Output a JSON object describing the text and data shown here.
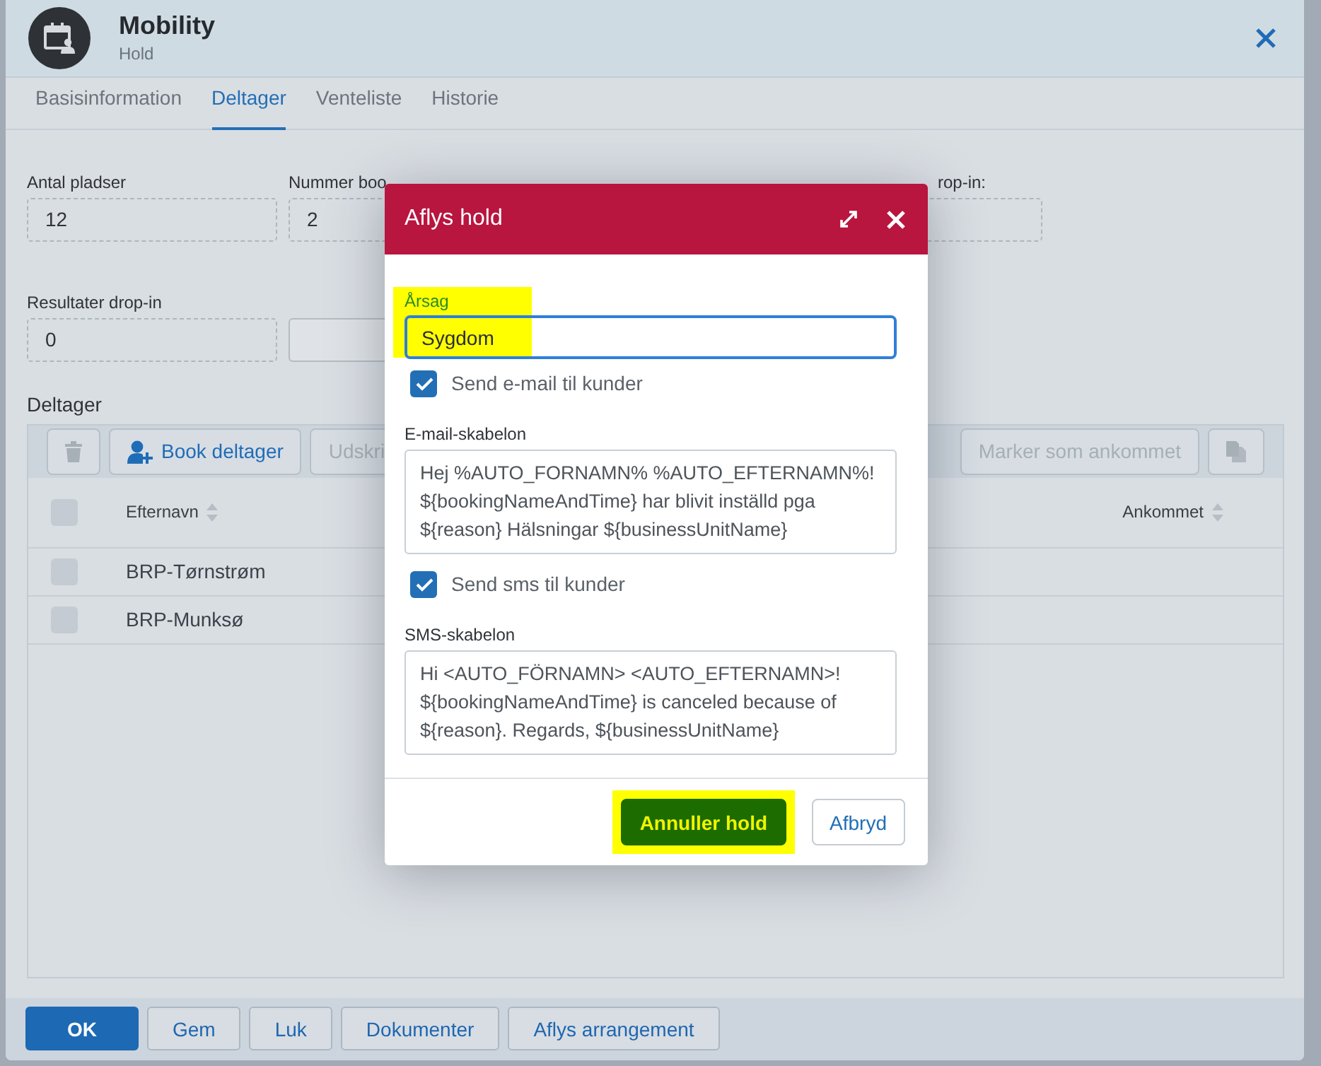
{
  "window": {
    "title": "Mobility",
    "subtitle": "Hold"
  },
  "tabs": [
    {
      "label": "Basisinformation",
      "selected": false
    },
    {
      "label": "Deltager",
      "selected": true
    },
    {
      "label": "Venteliste",
      "selected": false
    },
    {
      "label": "Historie",
      "selected": false
    }
  ],
  "fields": [
    {
      "kind": "readonly",
      "label": "Antal pladser",
      "value": "12"
    },
    {
      "kind": "readonly",
      "label": "Nummer boo",
      "value": "2"
    },
    {
      "kind": "readonly",
      "label": "rop-in:"
    },
    {
      "kind": "break"
    },
    {
      "kind": "readonly",
      "label": "Resultater drop-in",
      "value": "0"
    },
    {
      "kind": "input"
    }
  ],
  "participants": {
    "heading": "Deltager",
    "toolbar": [
      {
        "kind": "trash",
        "disabled": true
      },
      {
        "kind": "book",
        "label": "Book deltager",
        "disabled": false
      },
      {
        "kind": "text",
        "label": "Udskri",
        "disabled": true
      },
      {
        "kind": "gap"
      },
      {
        "kind": "text",
        "label": "Marker som ankommet",
        "disabled": true
      },
      {
        "kind": "copy",
        "disabled": true
      }
    ],
    "table": {
      "all_checked": false,
      "columns": [
        {
          "label": "Efternavn"
        },
        {
          "label": "Ankommet"
        }
      ],
      "rows": [
        {
          "name": "BRP-Tørnstrøm",
          "checked": false
        },
        {
          "name": "BRP-Munksø",
          "checked": false
        }
      ]
    }
  },
  "footer_buttons": [
    {
      "label": "OK",
      "kind": "primary"
    },
    {
      "label": "Gem",
      "kind": "secondary"
    },
    {
      "label": "Luk",
      "kind": "secondary"
    },
    {
      "label": "Dokumenter",
      "kind": "secondary"
    },
    {
      "label": "Aflys arrangement",
      "kind": "secondary"
    }
  ],
  "dialog": {
    "title": "Aflys hold",
    "reason": {
      "label": "Årsag",
      "value": "Sygdom",
      "highlighted": true
    },
    "sections": [
      {
        "kind": "checkbox",
        "label": "Send e-mail til kunder",
        "checked": true
      },
      {
        "kind": "template",
        "label": "E-mail-skabelon",
        "value": "Hej %AUTO_FORNAMN% %AUTO_EFTERNAMN%! ${bookingNameAndTime} har blivit inställd pga ${reason} Hälsningar ${businessUnitName}"
      },
      {
        "kind": "checkbox",
        "label": "Send sms til kunder",
        "checked": true
      },
      {
        "kind": "template",
        "label": "SMS-skabelon",
        "value": "Hi <AUTO_FÖRNAMN> <AUTO_EFTERNAMN>! ${bookingNameAndTime} is canceled because of ${reason}. Regards, ${businessUnitName}"
      }
    ],
    "buttons": [
      {
        "label": "Annuller hold",
        "kind": "confirm",
        "highlighted": true
      },
      {
        "label": "Afbryd",
        "kind": "cancel",
        "highlighted": false
      }
    ]
  }
}
